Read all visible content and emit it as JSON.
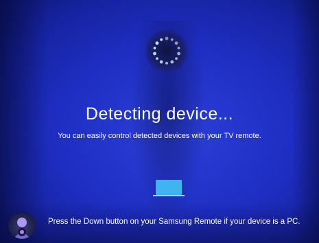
{
  "screen": {
    "title": "Detecting device...",
    "subtitle": "You can easily control detected devices with your TV remote.",
    "hint": "Press the Down button on your Samsung Remote if your device is a PC.",
    "spinner_icon": "loading-spinner-icon",
    "device_icon": "laptop-icon",
    "avatar_icon": "user-avatar-icon"
  },
  "colors": {
    "background": "#1f2fc4",
    "spinner_dots": "#d8f4ff",
    "device": "#3fb5ef",
    "text": "#ffffff"
  }
}
